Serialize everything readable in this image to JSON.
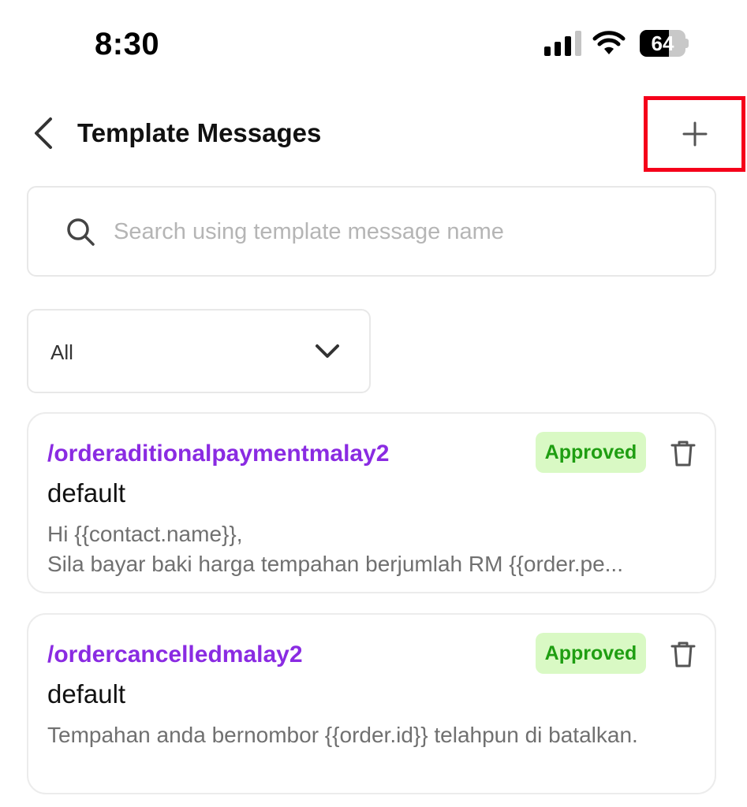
{
  "status_bar": {
    "time": "8:30",
    "battery_percent": 64,
    "battery_label": "64",
    "icons": [
      "signal-icon",
      "wifi-icon",
      "battery-icon"
    ]
  },
  "header": {
    "title": "Template Messages",
    "back_icon": "chevron-left-icon",
    "add_icon": "plus-icon"
  },
  "search": {
    "placeholder": "Search using template message name",
    "value": ""
  },
  "filter": {
    "selected": "All"
  },
  "templates": [
    {
      "name": "/orderaditionalpaymentmalay2",
      "category": "default",
      "status": "Approved",
      "body_lines": [
        "Hi {{contact.name}},",
        "Sila bayar baki harga tempahan berjumlah RM {{order.pe..."
      ]
    },
    {
      "name": "/ordercancelledmalay2",
      "category": "default",
      "status": "Approved",
      "body_lines": [
        "Tempahan anda bernombor {{order.id}} telahpun di batalkan."
      ]
    }
  ],
  "colors": {
    "template_name": "#8a2be2",
    "approved_bg": "#d9f9c4",
    "approved_text": "#1f9e12",
    "highlight_border": "#f5001a"
  }
}
